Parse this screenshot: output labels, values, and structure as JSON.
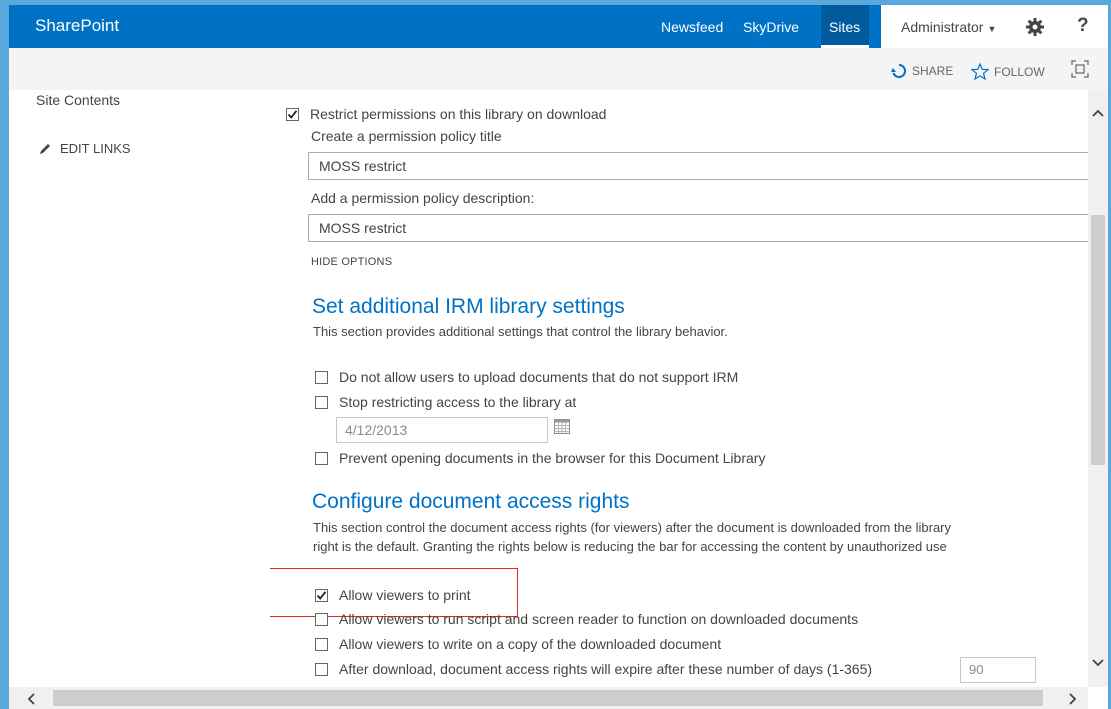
{
  "suitebar": {
    "brand": "SharePoint",
    "nav": [
      "Newsfeed",
      "SkyDrive",
      "Sites"
    ],
    "user": "Administrator",
    "help": "?"
  },
  "actionbar": {
    "share": "SHARE",
    "follow": "FOLLOW"
  },
  "leftnav": {
    "site_contents": "Site Contents",
    "edit_links": "EDIT LINKS"
  },
  "permissions": {
    "restrict_label": "Restrict permissions on this library on download",
    "restrict_checked": true,
    "title_label": "Create a permission policy title",
    "title_value": "MOSS restrict",
    "desc_label": "Add a permission policy description:",
    "desc_value": "MOSS restrict",
    "hide_options": "HIDE OPTIONS"
  },
  "irm_section": {
    "title": "Set additional IRM library settings",
    "description": "This section provides additional settings that control the library behavior.",
    "options": [
      {
        "label": "Do not allow users to upload documents that do not support IRM",
        "checked": false
      },
      {
        "label": "Stop restricting access to the library at",
        "checked": false
      },
      {
        "label": "Prevent opening documents in the browser for this Document Library",
        "checked": false
      }
    ],
    "date_value": "4/12/2013"
  },
  "access_section": {
    "title": "Configure document access rights",
    "description_line1": "This section control the document access rights (for viewers) after the document is downloaded from the library",
    "description_line2": "right is the default. Granting the rights below is reducing the bar for accessing the content by unauthorized use",
    "options": [
      {
        "label": "Allow viewers to print",
        "checked": true
      },
      {
        "label": "Allow viewers to run script and screen reader to function on downloaded documents",
        "checked": false
      },
      {
        "label": "Allow viewers to write on a copy of the downloaded document",
        "checked": false
      },
      {
        "label": "After download, document access rights will expire after these number of days (1-365)",
        "checked": false
      }
    ],
    "days_value": "90"
  },
  "colors": {
    "suitebar": "#0072c6",
    "accent": "#0072c6",
    "highlight": "#e02a2a"
  },
  "icons": [
    "gear-icon",
    "share-icon",
    "star-icon",
    "focus-icon",
    "pencil-icon",
    "calendar-icon",
    "checkmark-icon"
  ]
}
